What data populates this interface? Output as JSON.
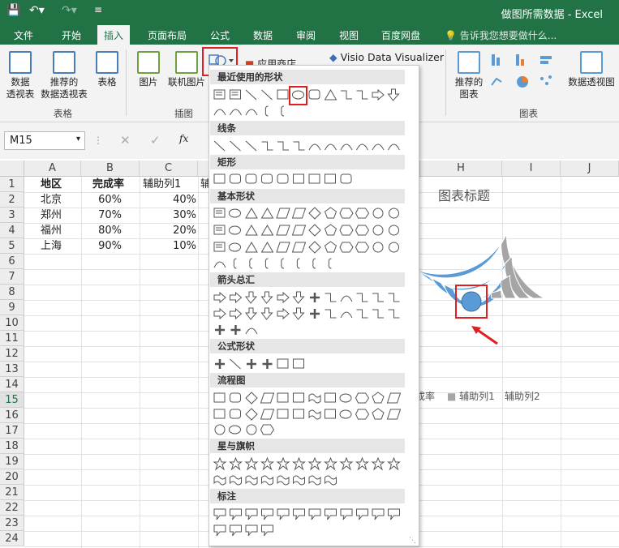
{
  "titlebar": {
    "save_icon": "save-icon",
    "undo_icon": "undo-icon",
    "redo_icon": "redo-icon",
    "title": "做图所需数据 - Excel"
  },
  "tabs": [
    "文件",
    "开始",
    "插入",
    "页面布局",
    "公式",
    "数据",
    "审阅",
    "视图",
    "百度网盘"
  ],
  "active_tab": "插入",
  "tell_me": "告诉我您想要做什么...",
  "ribbon": {
    "pivot_table": "数据\n透视表",
    "recommended_pivot": "推荐的\n数据透视表",
    "table": "表格",
    "picture": "图片",
    "online_picture": "联机图片",
    "app_store": "应用商店",
    "visio": "Visio Data Visualizer",
    "recommended_charts": "推荐的\n图表",
    "pivot_chart": "数据透视图",
    "group_tables": "表格",
    "group_illustrations": "插图",
    "group_charts": "图表"
  },
  "formula": {
    "name_box": "M15",
    "fx": "fx"
  },
  "columns": [
    "A",
    "B",
    "C",
    "H",
    "I",
    "J"
  ],
  "rows": [
    "1",
    "2",
    "3",
    "4",
    "5",
    "6",
    "7",
    "8",
    "9",
    "10",
    "11",
    "12",
    "13",
    "14",
    "15",
    "16",
    "17",
    "18",
    "19",
    "20",
    "21",
    "22",
    "23",
    "24"
  ],
  "selected_row": "15",
  "table": {
    "headers": [
      "地区",
      "完成率",
      "辅助列1",
      "辅"
    ],
    "data": [
      [
        "北京",
        "60%",
        "40%"
      ],
      [
        "郑州",
        "70%",
        "30%"
      ],
      [
        "福州",
        "80%",
        "20%"
      ],
      [
        "上海",
        "90%",
        "10%"
      ]
    ]
  },
  "shapes_menu": {
    "sections": [
      "最近使用的形状",
      "线条",
      "矩形",
      "基本形状",
      "箭头总汇",
      "公式形状",
      "流程图",
      "星与旗帜",
      "标注"
    ]
  },
  "chart": {
    "title": "图表标题",
    "legend": [
      "成率",
      "辅助列1",
      "辅助列2"
    ],
    "colors": {
      "series1": "#5b9bd5",
      "series2": "#a5a5a5",
      "highlight": "#e02020"
    }
  },
  "chart_data": {
    "type": "pie",
    "title": "图表标题",
    "categories": [
      "北京",
      "郑州",
      "福州",
      "上海"
    ],
    "series": [
      {
        "name": "完成率",
        "values": [
          0.6,
          0.7,
          0.8,
          0.9
        ]
      },
      {
        "name": "辅助列1",
        "values": [
          0.4,
          0.3,
          0.2,
          0.1
        ]
      }
    ]
  }
}
